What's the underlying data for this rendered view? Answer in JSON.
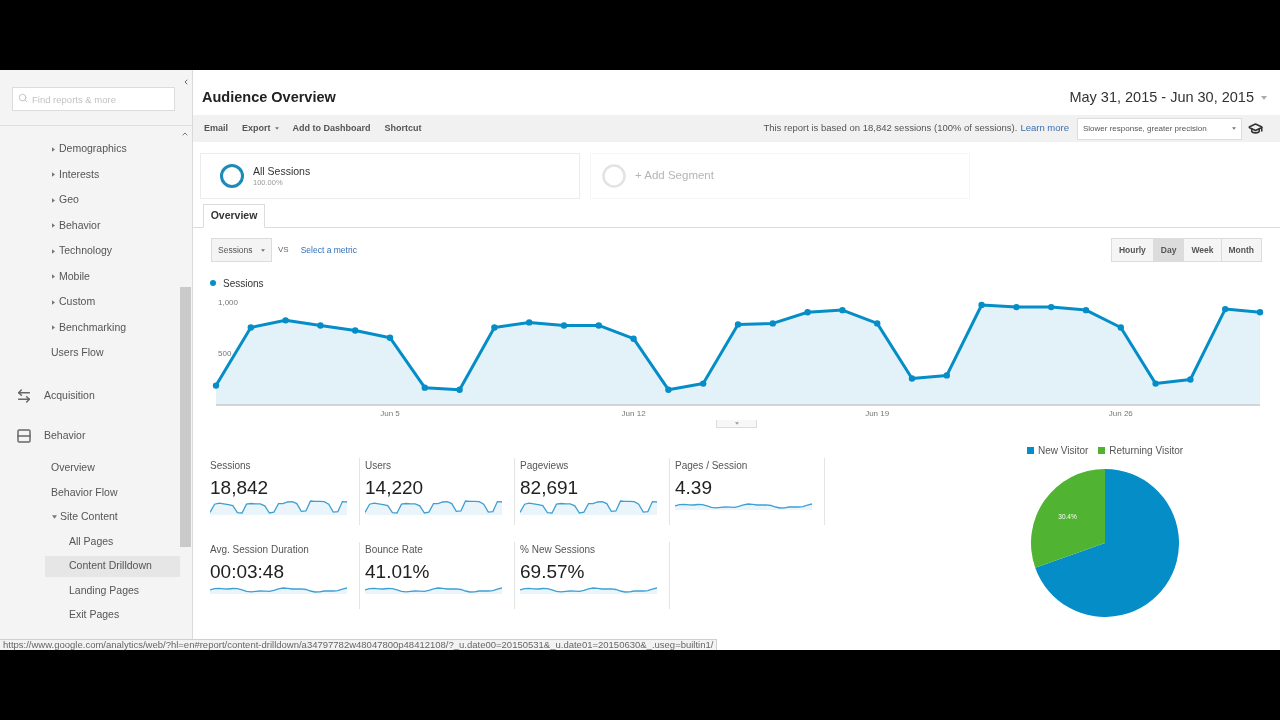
{
  "sidebar": {
    "search": {
      "placeholder": "Find reports & more"
    },
    "items": [
      {
        "kind": "group",
        "children": [
          {
            "label": "Demographics",
            "kind": "folder",
            "expanded": false
          },
          {
            "label": "Interests",
            "kind": "folder",
            "expanded": false
          },
          {
            "label": "Geo",
            "kind": "folder",
            "expanded": false
          },
          {
            "label": "Behavior",
            "kind": "folder",
            "expanded": false
          },
          {
            "label": "Technology",
            "kind": "folder",
            "expanded": false
          },
          {
            "label": "Mobile",
            "kind": "folder",
            "expanded": false
          },
          {
            "label": "Custom",
            "kind": "folder",
            "expanded": false
          },
          {
            "label": "Benchmarking",
            "kind": "folder",
            "expanded": false
          },
          {
            "label": "Users Flow",
            "kind": "link"
          }
        ]
      },
      {
        "kind": "section",
        "label": "Acquisition"
      },
      {
        "kind": "section",
        "label": "Behavior",
        "children": [
          {
            "label": "Overview",
            "kind": "link"
          },
          {
            "label": "Behavior Flow",
            "kind": "link"
          },
          {
            "label": "Site Content",
            "kind": "folder",
            "expanded": true,
            "children": [
              {
                "label": "All Pages",
                "kind": "link",
                "hovered": false
              },
              {
                "label": "Content Drilldown",
                "kind": "link",
                "hovered": true
              },
              {
                "label": "Landing Pages",
                "kind": "link",
                "hovered": false
              },
              {
                "label": "Exit Pages",
                "kind": "link",
                "hovered": false
              }
            ]
          }
        ]
      }
    ]
  },
  "header": {
    "title": "Audience Overview",
    "date_range": "May 31, 2015 - Jun 30, 2015"
  },
  "toolbar": {
    "actions": [
      {
        "label": "Email",
        "menu": false
      },
      {
        "label": "Export",
        "menu": true
      },
      {
        "label": "Add to Dashboard",
        "menu": false
      },
      {
        "label": "Shortcut",
        "menu": false
      }
    ],
    "report_note": "This report is based on 18,842 sessions (100% of sessions).",
    "learn_more": "Learn more",
    "precision": "Slower response, greater precision"
  },
  "segments": [
    {
      "kind": "active",
      "name": "All Sessions",
      "share": "100.00%"
    },
    {
      "kind": "add",
      "name": "+ Add Segment"
    }
  ],
  "tabs": [
    {
      "label": "Overview",
      "selected": true
    }
  ],
  "chart_controls": {
    "metric": "Sessions",
    "vs": "VS",
    "compare": "Select a metric",
    "intervals": [
      {
        "label": "Hourly",
        "selected": false
      },
      {
        "label": "Day",
        "selected": true
      },
      {
        "label": "Week",
        "selected": false
      },
      {
        "label": "Month",
        "selected": false
      }
    ]
  },
  "line_chart": {
    "chart_data": {
      "type": "area",
      "legend": "top",
      "categories": [
        null,
        null,
        null,
        null,
        null,
        "Jun 5",
        null,
        null,
        null,
        null,
        null,
        null,
        "Jun 12",
        null,
        null,
        null,
        null,
        null,
        null,
        "Jun 19",
        null,
        null,
        null,
        null,
        null,
        null,
        "Jun 26",
        null,
        null,
        null,
        null
      ],
      "series": [
        {
          "name": "Sessions",
          "color": "#058dc7",
          "marker": "circle",
          "values": [
            190,
            760,
            830,
            780,
            730,
            660,
            170,
            150,
            760,
            810,
            780,
            780,
            650,
            150,
            210,
            790,
            800,
            910,
            930,
            800,
            260,
            290,
            980,
            960,
            960,
            930,
            760,
            210,
            250,
            940,
            910
          ]
        }
      ],
      "ylim": [
        0,
        1000
      ],
      "yticks": [
        {
          "value": 500,
          "label": "500"
        },
        {
          "value": 1000,
          "label": "1,000"
        }
      ]
    }
  },
  "metrics": [
    {
      "label": "Sessions",
      "value": "18,842"
    },
    {
      "label": "Users",
      "value": "14,220"
    },
    {
      "label": "Pageviews",
      "value": "82,691"
    },
    {
      "label": "Pages / Session",
      "value": "4.39"
    },
    {
      "label": "Avg. Session Duration",
      "value": "00:03:48"
    },
    {
      "label": "Bounce Rate",
      "value": "41.01%"
    },
    {
      "label": "% New Sessions",
      "value": "69.57%"
    }
  ],
  "visitor_chart": {
    "chart_data": {
      "type": "pie",
      "legend": "top",
      "categories": [
        "New Visitor",
        "Returning Visitor"
      ],
      "values": [
        69.6,
        30.4
      ],
      "colors": [
        "#058dc7",
        "#50b432"
      ],
      "value_labels": [
        null,
        "30.4%"
      ]
    }
  },
  "status_bar": {
    "url": "https://www.google.com/analytics/web/?hl=en#report/content-drilldown/a34797782w48047800p48412108/?_u.date00=20150531&_u.date01=20150630&_.useg=builtin1/"
  }
}
